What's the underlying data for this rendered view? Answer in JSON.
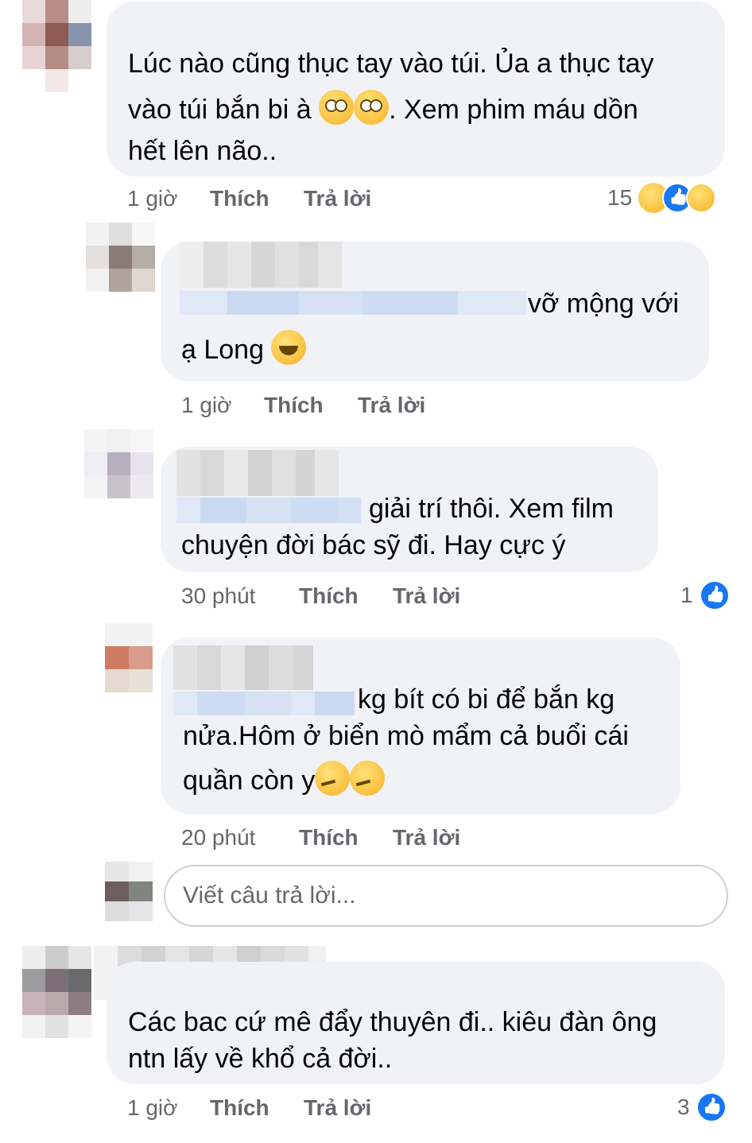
{
  "comments": [
    {
      "text_lines": [
        "Lúc nào cũng thục tay vào túi. Ủa a thục tay",
        "vào túi bắn bi à",
        ". Xem phim máu dồn",
        "hết lên não.."
      ],
      "time": "1 giờ",
      "like": "Thích",
      "reply": "Trả lời",
      "reaction_count": "15",
      "reactions": [
        "haha",
        "like",
        "sad"
      ]
    },
    {
      "text_lines": [
        "vỡ mộng với",
        "ạ Long"
      ],
      "time": "1 giờ",
      "like": "Thích",
      "reply": "Trả lời"
    },
    {
      "text_lines": [
        "giải trí thôi. Xem film",
        "chuyện đời bác sỹ đi. Hay cực ý"
      ],
      "time": "30 phút",
      "like": "Thích",
      "reply": "Trả lời",
      "reaction_count": "1",
      "reactions": [
        "like"
      ]
    },
    {
      "text_lines": [
        "kg bít có bi để bắn kg",
        "nửa.Hôm ở biển mò mẩm cả buổi cái",
        "quần còn y"
      ],
      "time": "20 phút",
      "like": "Thích",
      "reply": "Trả lời"
    },
    {
      "text_lines": [
        "Các bac cứ mê đẩy thuyên đi.. kiêu đàn ông",
        "ntn lấy về khổ cả đời.."
      ],
      "time": "1 giờ",
      "like": "Thích",
      "reply": "Trả lời",
      "reaction_count": "3",
      "reactions": [
        "like"
      ]
    }
  ],
  "reply_input": {
    "placeholder": "Viết câu trả lời..."
  },
  "emoji_names": [
    "face-with-rolling-eyes",
    "grinning-sweat",
    "thinking-face"
  ],
  "colors": {
    "bubble": "#f0f2f5",
    "meta_text": "#65676b",
    "like_blue": "#1877f2",
    "blurred_link": "#c9d9f2"
  }
}
